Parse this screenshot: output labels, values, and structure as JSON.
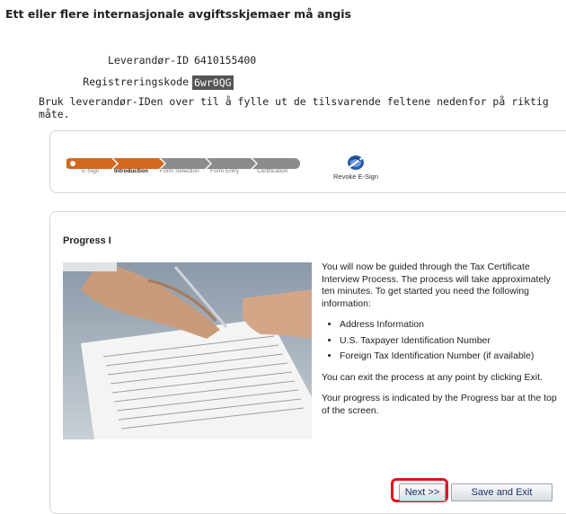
{
  "header": {
    "heading": "Ett eller flere internasjonale avgiftsskjemaer må angis"
  },
  "vendor": {
    "id_label": "Leverandør-ID",
    "id_value": "6410155400",
    "reg_label": "Registreringskode",
    "reg_value": "6wr0QG",
    "instruction": "Bruk leverandør-IDen over til å fylle ut de tilsvarende feltene nedenfor på riktig måte."
  },
  "progress": {
    "steps": [
      "E-Sign",
      "Introduction",
      "Form Selection",
      "Form Entry",
      "Certification"
    ],
    "active_step": "Introduction",
    "completed_color": "#d2691e",
    "pending_color": "#8c8c8c",
    "revoke_label": "Revoke E-Sign",
    "revoke_icon": "revoke-esign-icon"
  },
  "main": {
    "section_title": "Progress I",
    "intro_text": "You will now be guided through the Tax Certificate Interview Process. The process will take approximately ten minutes. To get started you need the following information:",
    "requirements": [
      "Address Information",
      "U.S. Taxpayer Identification Number",
      "Foreign Tax Identification Number (if available)"
    ],
    "exit_text": "You can exit the process at any point by clicking Exit.",
    "progress_text": "Your progress is indicated by the Progress bar at the top of the screen."
  },
  "buttons": {
    "next_label": "Next >>",
    "save_exit_label": "Save and Exit",
    "highlight_color": "#e0141f"
  }
}
